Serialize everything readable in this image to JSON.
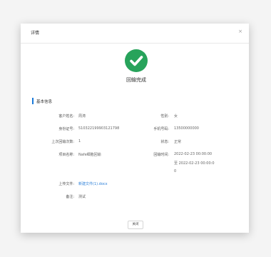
{
  "dialog": {
    "title": "详情",
    "close_glyph": "×",
    "status_text": "回输完成",
    "section_title": "基本信息",
    "footer_button": "关闭",
    "accent_color": "#1a7ad9",
    "success_color": "#27a35b"
  },
  "fields": {
    "customer_name": {
      "label": "客户姓名:",
      "value": "周涛"
    },
    "gender": {
      "label": "性别:",
      "value": "女"
    },
    "id_number": {
      "label": "身份证号:",
      "value": "510322199903121798"
    },
    "phone": {
      "label": "手机号码:",
      "value": "13500000000"
    },
    "previous_count": {
      "label": "上次回输次数:",
      "value": "1"
    },
    "status": {
      "label": "状态:",
      "value": "正常"
    },
    "project_name": {
      "label": "项目名称:",
      "value": "Nafe细胞回输"
    },
    "reinfusion_time": {
      "label": "回输时间:",
      "value": "2022-02-23 00:00:00",
      "value_cont": "至 2022-02-23 00:00:0",
      "value_cont2": "0"
    },
    "attachment": {
      "label": "上传文件:",
      "value": "新建文件(1).docx"
    },
    "remark": {
      "label": "备注:",
      "value": "测试"
    }
  }
}
